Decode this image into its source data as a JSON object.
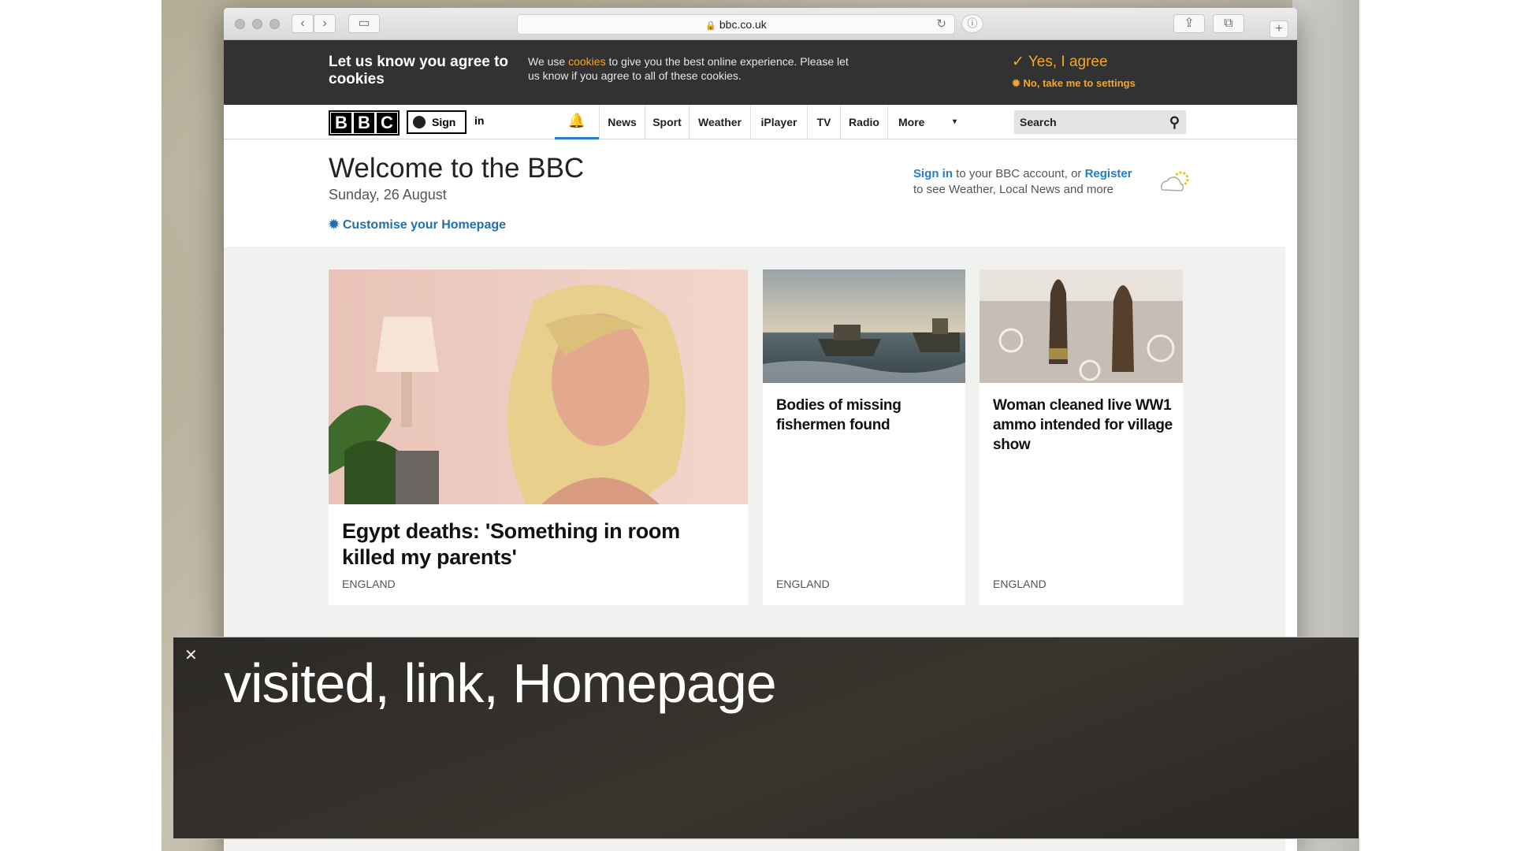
{
  "browser": {
    "url": "bbc.co.uk"
  },
  "cookie_banner": {
    "title": "Let us know you agree to cookies",
    "message_pre": "We use ",
    "message_link": "cookies",
    "message_post": " to give you the best online experience. Please let us know if you agree to all of these cookies.",
    "agree_label": "Yes, I agree",
    "settings_label": "No, take me to settings"
  },
  "nav": {
    "logo_letters": [
      "B",
      "B",
      "C"
    ],
    "signin_label": "Sign",
    "signin_extra": "in",
    "items": [
      "News",
      "Sport",
      "Weather",
      "iPlayer",
      "TV",
      "Radio",
      "More"
    ],
    "search_placeholder": "Search"
  },
  "welcome": {
    "title": "Welcome to the BBC",
    "date": "Sunday, 26 August",
    "customise": "Customise your Homepage",
    "signin_link": "Sign in",
    "account_text_1": " to your BBC account, or ",
    "register_link": "Register",
    "account_text_2": "to see Weather, Local News and more"
  },
  "stories": [
    {
      "headline": "Egypt deaths: 'Something in room killed my parents'",
      "tag": "ENGLAND"
    },
    {
      "headline": "Bodies of missing fishermen found",
      "tag": "ENGLAND"
    },
    {
      "headline": "Woman cleaned live WW1 ammo intended for village show",
      "tag": "ENGLAND"
    }
  ],
  "caption": {
    "text": "visited, link, Homepage"
  },
  "colors": {
    "accent_orange": "#f5a623",
    "link_blue": "#1f7ed1",
    "banner_dark": "#323232"
  }
}
